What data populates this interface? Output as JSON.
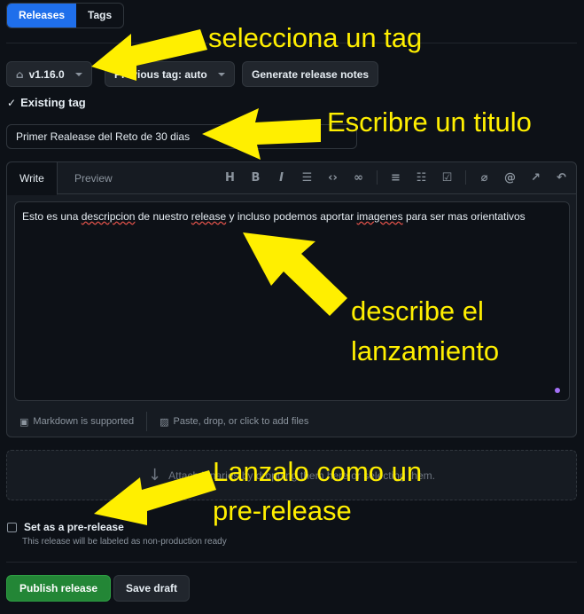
{
  "tabs": {
    "releases": "Releases",
    "tags": "Tags"
  },
  "tag_picker": {
    "value": "v1.16.0",
    "previous": "Previous tag: auto",
    "generate": "Generate release notes"
  },
  "existing_tag": "Existing tag",
  "title_input": {
    "value": "Primer Realease del Reto de 30 dias"
  },
  "editor": {
    "tab_write": "Write",
    "tab_preview": "Preview",
    "toolbar": [
      "H",
      "B",
      "I",
      "quote",
      "code",
      "link",
      "ordered-list",
      "unordered-list",
      "task-list",
      "attach",
      "mention",
      "reference",
      "undo"
    ],
    "body_prefix": "Esto es una ",
    "body_typo1": "descripcion",
    "body_mid1": " de nuestro ",
    "body_typo2": "release",
    "body_mid2": " y incluso podemos aportar ",
    "body_typo3": "imagenes",
    "body_suffix": " para ser mas orientativos",
    "markdown": "Markdown is supported",
    "attach_files": "Paste, drop, or click to add files"
  },
  "drop_zone": "Attach binaries by dropping them here or selecting them.",
  "prerelease": {
    "label": "Set as a pre-release",
    "hint": "This release will be labeled as non-production ready"
  },
  "actions": {
    "publish": "Publish release",
    "draft": "Save draft"
  },
  "annotations": {
    "tag": "selecciona un tag",
    "title": "Escribre un titulo",
    "describe_1": "describe el",
    "describe_2": "lanzamiento",
    "prerelease_1": "Lanzalo como un",
    "prerelease_2": "pre-release",
    "color": "#ffef00"
  },
  "colors": {
    "accent": "#1f6feb",
    "publish": "#238636",
    "background": "#0d1117"
  }
}
